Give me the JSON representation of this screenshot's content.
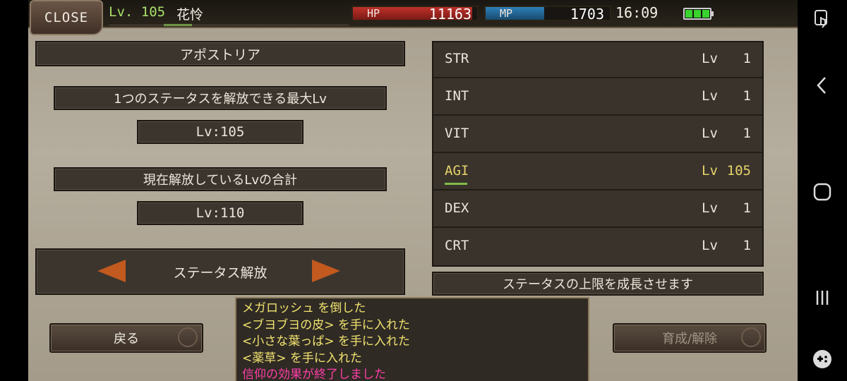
{
  "header": {
    "close_label": "CLOSE",
    "level_text": "Lv. 105",
    "character_name": "花怜",
    "hp": {
      "label": "HP",
      "value": "11163",
      "fill": 0.96,
      "color": "#c0312a"
    },
    "mp": {
      "label": "MP",
      "value": "1703",
      "fill": 0.47,
      "color": "#2e7fb8"
    },
    "clock": "16:09",
    "battery_color": "#38d32c"
  },
  "left": {
    "title": "アポストリア",
    "max_label": "1つのステータスを解放できる最大Lv",
    "max_value": "Lv:105",
    "total_label": "現在解放しているLvの合計",
    "total_value": "Lv:110",
    "mode_label": "ステータス解放"
  },
  "stats": [
    {
      "name": "STR",
      "lv_label": "Lv",
      "value": "1"
    },
    {
      "name": "INT",
      "lv_label": "Lv",
      "value": "1"
    },
    {
      "name": "VIT",
      "lv_label": "Lv",
      "value": "1"
    },
    {
      "name": "AGI",
      "lv_label": "Lv",
      "value": "105"
    },
    {
      "name": "DEX",
      "lv_label": "Lv",
      "value": "1"
    },
    {
      "name": "CRT",
      "lv_label": "Lv",
      "value": "1"
    }
  ],
  "description": "ステータスの上限を成長させます",
  "log": [
    "メガロッシュ を倒した",
    "<ブヨブヨの皮> を手に入れた",
    "<小さな葉っぱ> を手に入れた",
    "<薬草> を手に入れた",
    "信仰の効果が終了しました"
  ],
  "buttons": {
    "back": "戻る",
    "train": "育成/解除"
  },
  "accent_colors": {
    "highlight": "#e6d36a",
    "log_text": "#f1e36f",
    "log_alert": "#ff3fa8",
    "arrow": "#c2591f"
  }
}
